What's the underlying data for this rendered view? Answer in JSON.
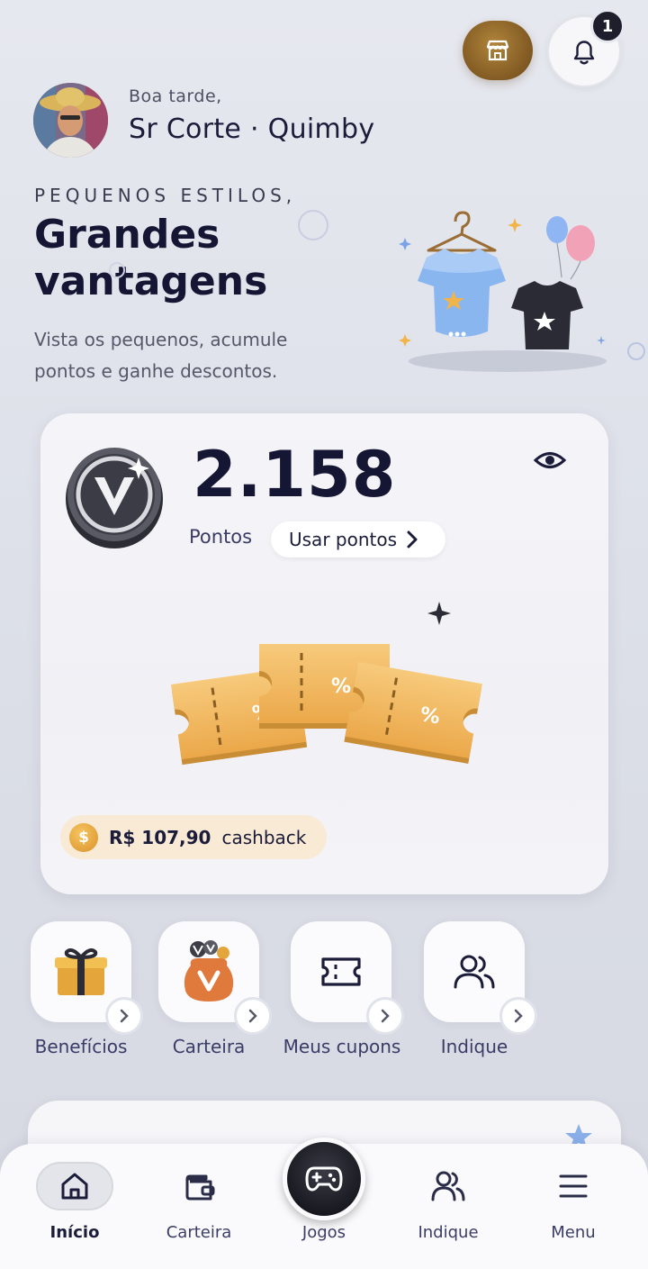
{
  "header": {
    "store_icon": "store-icon",
    "bell_icon": "bell-icon",
    "notification_count": "1"
  },
  "user": {
    "greeting": "Boa tarde,",
    "name": "Sr Corte · Quimby"
  },
  "hero": {
    "eyebrow": "PEQUENOS ESTILOS,",
    "headline": "Grandes vantagens",
    "subtitle": "Vista os pequenos, acumule pontos e ganhe descontos."
  },
  "points_card": {
    "points": "2.158",
    "points_label": "Pontos",
    "use_points_label": "Usar pontos",
    "cashback_value": "R$ 107,90",
    "cashback_label": "cashback",
    "coin_symbol": "$"
  },
  "shortcuts": [
    {
      "label": "Benefícios",
      "icon": "gift-icon"
    },
    {
      "label": "Carteira",
      "icon": "wallet-bag-icon"
    },
    {
      "label": "Meus cupons",
      "icon": "ticket-icon"
    },
    {
      "label": "Indique",
      "icon": "users-icon"
    }
  ],
  "nav": {
    "items": [
      {
        "label": "Início",
        "icon": "home-icon",
        "active": true
      },
      {
        "label": "Carteira",
        "icon": "wallet-icon",
        "active": false
      },
      {
        "label": "Jogos",
        "icon": "gamepad-icon",
        "active": false
      },
      {
        "label": "Indique",
        "icon": "users-icon",
        "active": false
      },
      {
        "label": "Menu",
        "icon": "menu-icon",
        "active": false
      }
    ]
  },
  "colors": {
    "primary_dark": "#151633",
    "accent_gold": "#b0843a",
    "cashback_bg": "#f9ead6",
    "ticket_orange": "#f0b660"
  }
}
